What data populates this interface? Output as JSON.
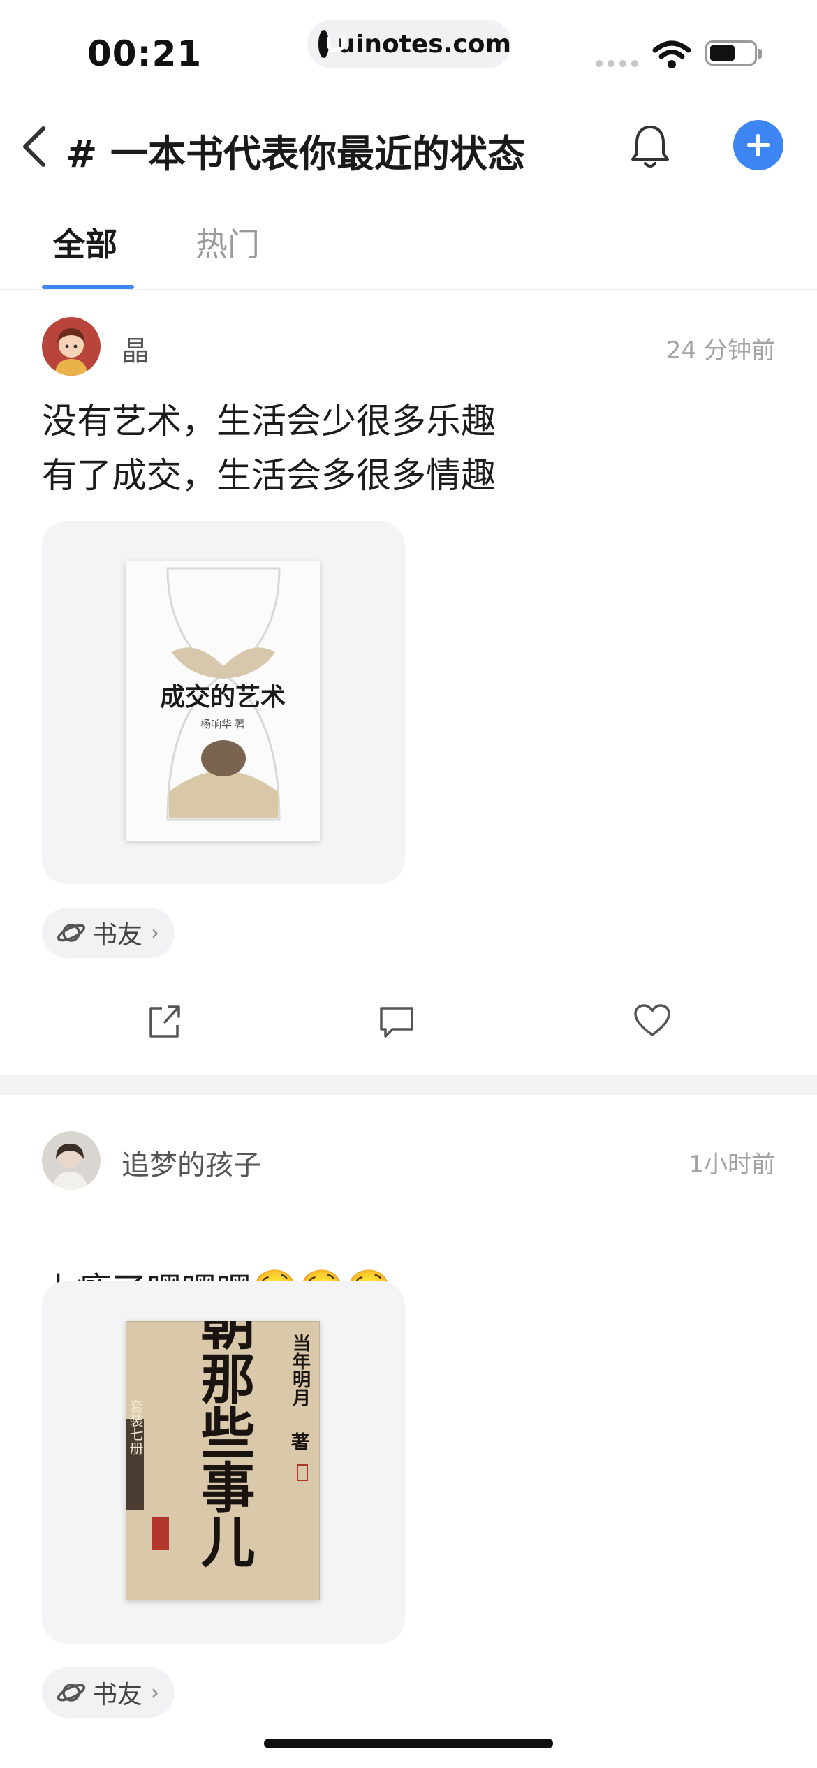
{
  "status_bar": {
    "time": "00:21",
    "url": "uinotes.com"
  },
  "header": {
    "title": "# 一本书代表你最近的状态"
  },
  "tabs": [
    {
      "label": "全部",
      "active": true
    },
    {
      "label": "热门",
      "active": false
    }
  ],
  "posts": [
    {
      "username": "晶",
      "time": "24 分钟前",
      "text": "没有艺术，生活会少很多乐趣\n有了成交，生活会多很多情趣",
      "book_title": "成交的艺术",
      "book_author": "杨响华 著",
      "tag": "书友"
    },
    {
      "username": "追梦的孩子",
      "time": "1小时前",
      "text": "上瘾了嘿嘿嘿",
      "emoji": "🤤🤤🤤",
      "book_title": "明朝那些事儿",
      "book_author": "当年明月",
      "book_author_suffix": "著",
      "book_badge": "套装七册",
      "tag": "书友"
    }
  ],
  "colors": {
    "accent": "#3d85f3",
    "muted": "#a3a3a3",
    "divider": "#f3f3f5"
  }
}
